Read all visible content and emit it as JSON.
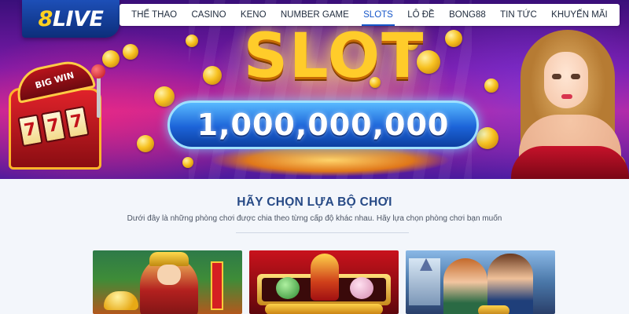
{
  "brand": {
    "logo_number": "8",
    "logo_text": "LIVE",
    "accent_color": "#1656c9",
    "title_color": "#274a86"
  },
  "nav": {
    "items": [
      {
        "label": "THỂ THAO",
        "active": false
      },
      {
        "label": "CASINO",
        "active": false
      },
      {
        "label": "KENO",
        "active": false
      },
      {
        "label": "NUMBER GAME",
        "active": false
      },
      {
        "label": "SLOTS",
        "active": true
      },
      {
        "label": "LÔ ĐỀ",
        "active": false
      },
      {
        "label": "BONG88",
        "active": false
      },
      {
        "label": "TIN TỨC",
        "active": false
      },
      {
        "label": "KHUYẾN MÃI",
        "active": false
      }
    ]
  },
  "hero": {
    "machine_sign": "BIG WIN",
    "reels": [
      "7",
      "7",
      "7"
    ],
    "title": "SLOT",
    "jackpot": "1,000,000,000"
  },
  "section": {
    "title": "HÃY CHỌN LỰA BỘ CHƠI",
    "description": "Dưới đây là những phòng chơi được chia theo từng cấp độ khác nhau. Hãy lựa chọn phòng chơi bạn muốn"
  },
  "games": [
    {
      "icon": "god-of-wealth-icon"
    },
    {
      "icon": "master-chens-fortune-icon"
    },
    {
      "icon": "fairytale-couple-icon"
    }
  ]
}
